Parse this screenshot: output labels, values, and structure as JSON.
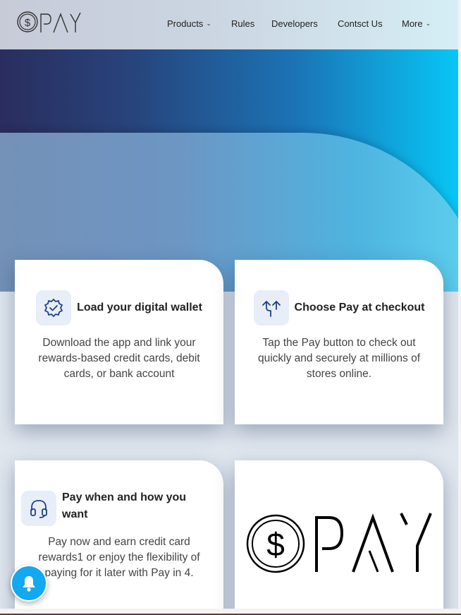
{
  "brand": {
    "logo_text": "PAY",
    "logo_symbol": "$"
  },
  "nav": {
    "items": [
      {
        "label": "Products",
        "has_dropdown": true
      },
      {
        "label": "Rules",
        "has_dropdown": false
      },
      {
        "label": "Developers",
        "has_dropdown": false
      },
      {
        "label": "Contsct Us",
        "has_dropdown": false
      },
      {
        "label": "More",
        "has_dropdown": true
      }
    ],
    "chevron": "⌄"
  },
  "features": [
    {
      "title": "Load your digital wallet",
      "text": "Download the app and link your rewards-based credit cards, debit cards, or bank account",
      "icon": "badge-check-icon"
    },
    {
      "title": "Choose Pay at checkout",
      "text": "Tap the Pay button to check out quickly and securely at millions of stores online.",
      "icon": "split-arrows-icon"
    },
    {
      "title": "Pay when and how you want",
      "text": "Pay now and earn credit card rewards1 or enjoy the flexibility of paying for it later with Pay in 4.",
      "icon": "headset-icon"
    }
  ],
  "logo_card": {
    "logo_text": "PAY",
    "logo_symbol": "$"
  },
  "colors": {
    "accent": "#12a9f0",
    "icon_stroke": "#1f3f8a",
    "icon_bg": "#e8eef8"
  }
}
